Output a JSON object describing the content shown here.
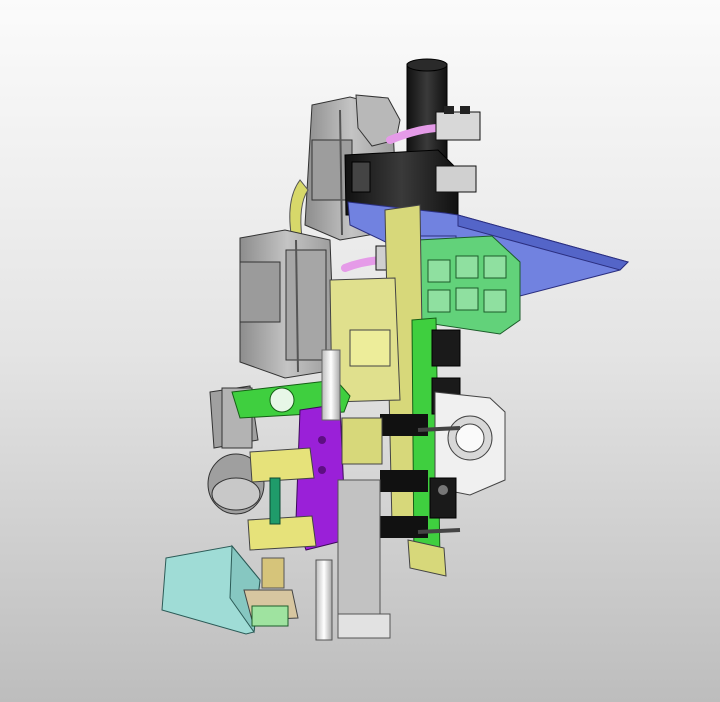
{
  "scene": {
    "kind": "cad-assembly-render",
    "colors": {
      "background_top": "#fbfbfb",
      "background_bottom": "#bdbdbd",
      "motor_gray": "#a9a9a9",
      "motor_dark": "#7c7c7c",
      "black_part": "#1e1e1e",
      "blue_plate": "#6f7fdc",
      "green_part": "#3fcf3f",
      "green_connector": "#5fd07a",
      "yellow_part": "#d9d98a",
      "olive_part": "#c7c75a",
      "purple_plate": "#9a20d8",
      "cyan_box": "#9fdcd6",
      "pink_cable": "#e59be8",
      "white_flange": "#f0f0f0",
      "teal_shaft": "#1f9b6a",
      "brass": "#d6c47a"
    },
    "parts": [
      "servo-motor-top",
      "servo-motor-middle",
      "servo-motor-bottom",
      "black-mount-block",
      "blue-mount-plate",
      "green-terminal-block",
      "green-rail-plate",
      "yellow-guide-block",
      "purple-bracket",
      "white-flange-plate",
      "cyan-housing",
      "vertical-shafts",
      "pink-cables",
      "connectors"
    ]
  }
}
